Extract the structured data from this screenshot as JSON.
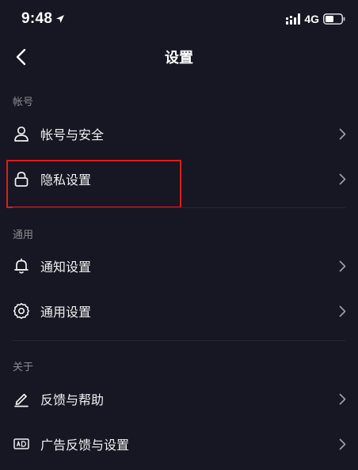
{
  "status_bar": {
    "time": "9:48",
    "network": "4G",
    "icons": [
      "location-arrow-icon",
      "signal-icon",
      "battery-icon"
    ]
  },
  "nav": {
    "title": "设置",
    "back_icon": "back-chevron-icon"
  },
  "sections": [
    {
      "header": "帐号",
      "items": [
        {
          "label": "帐号与安全",
          "icon": "person-icon"
        },
        {
          "label": "隐私设置",
          "icon": "lock-icon"
        }
      ]
    },
    {
      "header": "通用",
      "items": [
        {
          "label": "通知设置",
          "icon": "bell-icon"
        },
        {
          "label": "通用设置",
          "icon": "gear-icon"
        }
      ]
    },
    {
      "header": "关于",
      "items": [
        {
          "label": "反馈与帮助",
          "icon": "edit-icon"
        },
        {
          "label": "广告反馈与设置",
          "icon": "ad-icon"
        }
      ]
    }
  ],
  "colors": {
    "background": "#161722",
    "text": "#f1f1f3",
    "section_header": "#8a8b92",
    "divider": "#262733",
    "highlight": "#e11a1f"
  }
}
